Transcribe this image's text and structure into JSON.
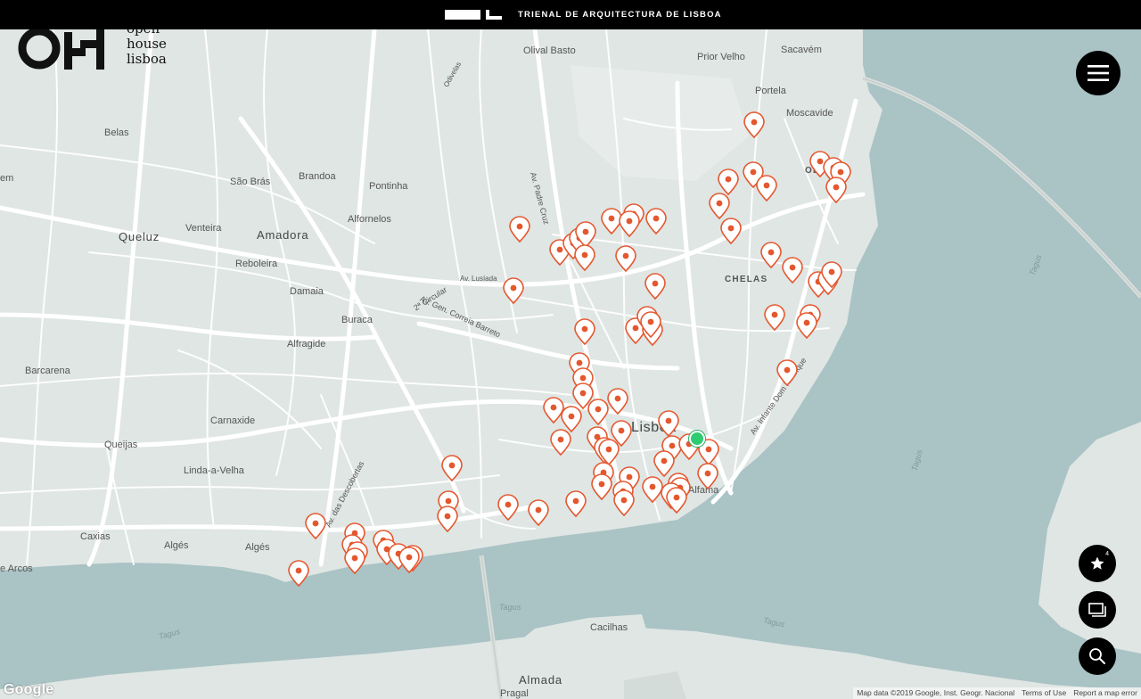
{
  "topbar": {
    "title": "TRIENAL DE ARQUITECTURA DE LISBOA"
  },
  "brand": {
    "line1": "open",
    "line2": "house",
    "line3": "lisboa"
  },
  "map": {
    "labels": {
      "belas": "Belas",
      "sao_bras": "São Brás",
      "brandoa": "Brandoa",
      "pontinha": "Pontinha",
      "olival_basto": "Olival Basto",
      "prior_velho": "Prior Velho",
      "sacavem": "Sacavém",
      "portela": "Portela",
      "moscavide": "Moscavide",
      "queluz": "Queluz",
      "venteira": "Venteira",
      "amadora": "Amadora",
      "alfornelos": "Alfornelos",
      "reboleira": "Reboleira",
      "damaia": "Damaia",
      "buraca": "Buraca",
      "alfragide": "Alfragide",
      "barcarena": "Barcarena",
      "carnaxide": "Carnaxide",
      "queijas": "Queijas",
      "linda_a_velha": "Linda-a-Velha",
      "caxias": "Caxias",
      "alges1": "Algés",
      "alges2": "Algés",
      "arcos": "e Arcos",
      "lisboa": "Lisboa",
      "alfama": "Alfama",
      "chelas": "CHELAS",
      "olivais": "OLIVAIS",
      "cacilhas": "Cacilhas",
      "almada": "Almada",
      "pragal": "Pragal",
      "em": "em",
      "circular": "2ª Circular",
      "correia_barreto": "Av. Gen. Correia Barreto",
      "padre_cruz": "Av. Padre Cruz",
      "dom_henrique": "Av. Infante Dom Henrique",
      "tagus1": "Tagus",
      "tagus2": "Tagus",
      "tagus3": "Tagus",
      "tagus4": "Tagus",
      "tagus5": "Tagus",
      "lusiada": "Av. Lusíada",
      "descobertas": "Av. das Descobertas",
      "odivelas": "Odivelas"
    },
    "pin_color": "#e4572e",
    "current_location_color": "#2ecc71",
    "water_color": "#aac3c5",
    "land_color": "#dfe6e4"
  },
  "controls": {
    "favorites_icon": "star-icon",
    "favorites_count": "4",
    "gallery_icon": "gallery-icon",
    "search_icon": "search-icon",
    "menu_icon": "hamburger-icon"
  },
  "footer": {
    "google": "Google",
    "map_data": "Map data ©2019 Google, Inst. Geogr. Nacional",
    "terms": "Terms of Use",
    "report": "Report a map error"
  }
}
